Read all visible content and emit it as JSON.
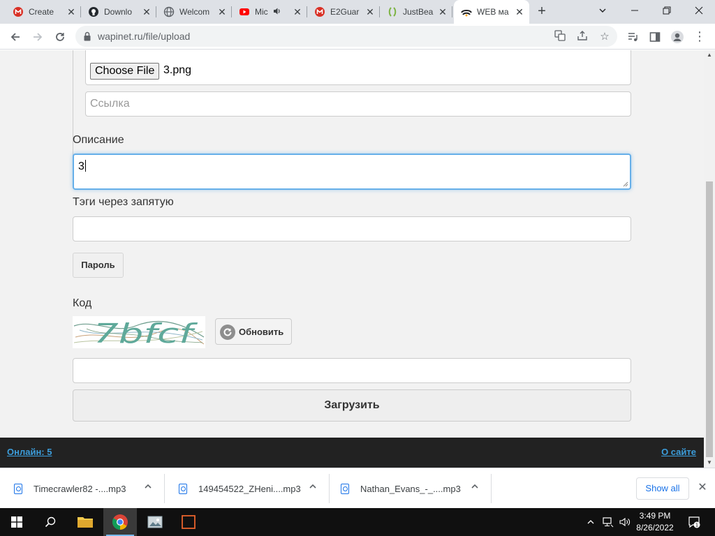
{
  "browser": {
    "tabs": [
      {
        "title": "Create",
        "favicon": "gmail-icon",
        "active": false
      },
      {
        "title": "Downlo",
        "favicon": "github-icon",
        "active": false
      },
      {
        "title": "Welcom",
        "favicon": "globe-icon",
        "active": false
      },
      {
        "title": "Mic",
        "favicon": "youtube-icon",
        "active": false,
        "playing_audio": true
      },
      {
        "title": "E2Guar",
        "favicon": "gmail-icon",
        "active": false
      },
      {
        "title": "JustBea",
        "favicon": "justbeat-icon",
        "active": false
      },
      {
        "title": "WEB ма",
        "favicon": "wapinet-icon",
        "active": true
      }
    ],
    "url": "wapinet.ru/file/upload"
  },
  "form": {
    "file_button": "Choose File",
    "file_name": "3.png",
    "link_placeholder": "Ссылка",
    "description_label": "Описание",
    "description_value": "3",
    "tags_label": "Тэги через запятую",
    "tags_value": "",
    "password_button": "Пароль",
    "code_label": "Код",
    "captcha_text": "7bfcf",
    "refresh_button": "Обновить",
    "code_value": "",
    "submit_button": "Загрузить"
  },
  "footer": {
    "online": "Онлайн: 5",
    "about": "О сайте"
  },
  "downloads": {
    "items": [
      {
        "name": "Timecrawler82 -....mp3"
      },
      {
        "name": "149454522_ZHeni....mp3"
      },
      {
        "name": "Nathan_Evans_-_....mp3"
      }
    ],
    "show_all": "Show all"
  },
  "taskbar": {
    "time": "3:49 PM",
    "date": "8/26/2022",
    "notification_count": "1"
  },
  "colors": {
    "link": "#3c9ddb",
    "focus": "#66afe9",
    "footer_bg": "#222222",
    "content_bg": "#f2f2f2"
  }
}
